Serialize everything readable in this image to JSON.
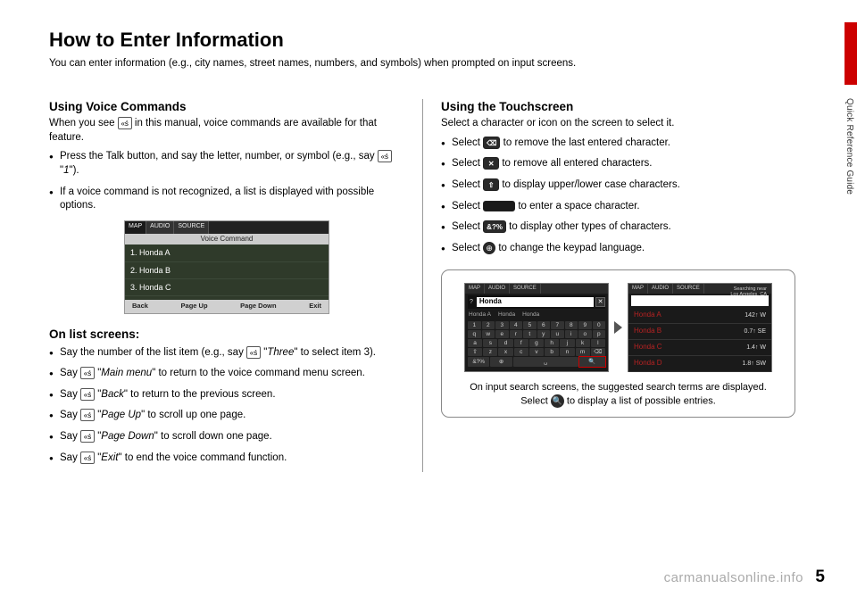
{
  "side_label": "Quick Reference Guide",
  "page_number": "5",
  "watermark": "carmanualsonline.info",
  "title": "How to Enter Information",
  "intro": "You can enter information (e.g., city names, street names, numbers, and symbols) when prompted on input screens.",
  "voice": {
    "heading": "Using Voice Commands",
    "lead1": "When you see ",
    "lead2": " in this manual, voice commands are available for that feature.",
    "bullets": [
      {
        "a": "Press the Talk button, and say the letter, number, or symbol (e.g., say ",
        "cmd": "1",
        "b": ")."
      },
      {
        "a": "If a voice command is not recognized, a list is displayed with possible options.",
        "cmd": "",
        "b": ""
      }
    ],
    "screenshot": {
      "tabs": [
        "MAP",
        "AUDIO",
        "SOURCE"
      ],
      "title": "Voice Command",
      "rows": [
        "1. Honda A",
        "2. Honda B",
        "3. Honda C"
      ],
      "footer": [
        "Back",
        "Page Up",
        "Page Down",
        "Exit"
      ]
    },
    "list_heading": "On list screens:",
    "list_items": [
      {
        "a": "Say the number of the list item (e.g., say ",
        "cmd": "Three",
        "b": " to select item 3)."
      },
      {
        "a": "Say ",
        "cmd": "Main menu",
        "b": " to return to the voice command menu screen."
      },
      {
        "a": "Say ",
        "cmd": "Back",
        "b": " to return to the previous screen."
      },
      {
        "a": "Say ",
        "cmd": "Page Up",
        "b": " to scroll up one page."
      },
      {
        "a": "Say ",
        "cmd": "Page Down",
        "b": " to scroll down one page."
      },
      {
        "a": "Say ",
        "cmd": "Exit",
        "b": " to end the voice command function."
      }
    ]
  },
  "touch": {
    "heading": "Using the Touchscreen",
    "lead": "Select a character or icon on the screen to select it.",
    "bullets": [
      {
        "a": "Select ",
        "icon": "⌫",
        "cls": "icon-box",
        "b": " to remove the last entered character."
      },
      {
        "a": "Select ",
        "icon": "✕",
        "cls": "icon-box",
        "b": " to remove all entered characters."
      },
      {
        "a": "Select ",
        "icon": "⇧",
        "cls": "icon-box",
        "b": " to display upper/lower case characters."
      },
      {
        "a": "Select ",
        "icon": " ",
        "cls": "icon-box wide",
        "b": " to enter a space character."
      },
      {
        "a": "Select ",
        "icon": "&?%",
        "cls": "icon-box",
        "b": " to display other types of characters."
      },
      {
        "a": "Select ",
        "icon": "⊕",
        "cls": "round-icon",
        "b": " to change the keypad language."
      }
    ],
    "shot_kbd": {
      "tabs": [
        "MAP",
        "AUDIO",
        "SOURCE"
      ],
      "field": "Honda",
      "hints": [
        "Honda A",
        "Honda",
        "Honda"
      ],
      "rows": [
        [
          "1",
          "2",
          "3",
          "4",
          "5",
          "6",
          "7",
          "8",
          "9",
          "0"
        ],
        [
          "q",
          "w",
          "e",
          "r",
          "t",
          "y",
          "u",
          "i",
          "o",
          "p"
        ],
        [
          "a",
          "s",
          "d",
          "f",
          "g",
          "h",
          "j",
          "k",
          "l"
        ],
        [
          "⇧",
          "z",
          "x",
          "c",
          "v",
          "b",
          "n",
          "m",
          "⌫"
        ]
      ],
      "bottom": [
        "&?%",
        "⊕",
        "␣",
        "🔍"
      ]
    },
    "shot_list": {
      "tabs": [
        "MAP",
        "AUDIO",
        "SOURCE"
      ],
      "near": "Searching near\nLos Angeles, CA",
      "rows": [
        {
          "name": "Honda A",
          "dist": "142↑  W"
        },
        {
          "name": "Honda B",
          "dist": "0.7↑  SE"
        },
        {
          "name": "Honda C",
          "dist": "1.4↑  W"
        },
        {
          "name": "Honda D",
          "dist": "1.8↑  SW"
        }
      ]
    },
    "callout1": "On input search screens, the suggested search terms are displayed. Select ",
    "callout2": " to display a list of possible entries."
  }
}
